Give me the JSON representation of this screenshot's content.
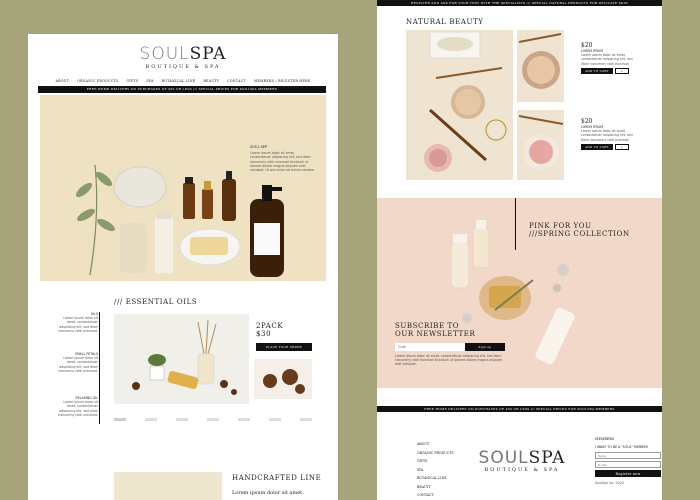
{
  "brand": {
    "name_a": "SOUL",
    "name_b": "SPA",
    "tagline": "BOUTIQUE & SPA"
  },
  "nav": {
    "items": [
      "ABOUT",
      "ORGANIC PRODUCTS",
      "GIFTS",
      "SPA",
      "BOTANICAL LINE",
      "BEAUTY",
      "CONTACT",
      "MEMBERS / REGISTER HERE"
    ]
  },
  "promo_banner": "FREE HOME DELIVERY ON PURCHASES OF $50 OR LESS /// SPECIAL PRICES FOR SOULSPA MEMBERS",
  "top_banner": "REGISTER AND ASK FOR YOUR TEST WITH THE SPECIALISTS /// SPECIAL NATURAL PRODUCTS FOR DELICATE SKIN",
  "hero": {
    "tag": "SOUL SPF",
    "text": "Lorem ipsum dolor sit amet, consectetuer adipiscing elit, sed diam nonummy nibh euismod tincidunt ut laoreet dolore magna aliquam erat volutpat. Ut wisi enim ad minim veniam."
  },
  "essential_oils": {
    "title": "/// ESSENTIAL OILS",
    "side_items": [
      {
        "label": "OILS",
        "text": "Lorem ipsum dolor sit amet, consectetuer adipiscing elit, sed diam nonummy nibh euismod."
      },
      {
        "label": "SMALL PETALS",
        "text": "Lorem ipsum dolor sit amet, consectetuer adipiscing elit, sed diam nonummy nibh euismod."
      },
      {
        "label": "RELAXING OIL",
        "text": "Lorem ipsum dolor sit amet, consectetuer adipiscing elit, sed diam nonummy nibh euismod."
      }
    ],
    "pack_title": "2PACK",
    "pack_price": "$30",
    "order_button": "PLACE YOUR ORDER"
  },
  "handcrafted": {
    "title": "HANDCRAFTED LINE",
    "text": "Lorem ipsum dolor sit amet,"
  },
  "natural_beauty": {
    "title": "NATURAL BEAUTY",
    "products": [
      {
        "price": "$20",
        "name": "LOREM IPSUM",
        "text": "Lorem ipsum dolor sit amet, consectetuer adipiscing elit, sed diam nonummy nibh euismod tincidunt ut laoreet dolore magna.",
        "cart": "ADD TO CART",
        "qty": "1"
      },
      {
        "price": "$20",
        "name": "LOREM IPSUM",
        "text": "Lorem ipsum dolor sit amet, consectetuer adipiscing elit, sed diam nonummy nibh euismod tincidunt ut laoreet dolore magna.",
        "cart": "ADD TO CART",
        "qty": "1"
      }
    ]
  },
  "spring": {
    "line1": "PINK FOR YOU",
    "line2": "///SPRING COLLECTION"
  },
  "newsletter": {
    "line1": "SUBSCRIBE TO",
    "line2": "OUR NEWSLETTER",
    "placeholder": "Email",
    "button": "Sign up",
    "text": "Lorem ipsum dolor sit amet, consectetuer adipiscing elit, sed diam nonummy nibh euismod tincidunt ut laoreet dolore magna aliquam erat volutpat."
  },
  "footer": {
    "links": [
      "ABOUT",
      "ORGANIC PRODUCTS",
      "GIFTS",
      "SPA",
      "BOTANICAL LINE",
      "BEAUTY",
      "CONTACT"
    ],
    "members_title": "MEMBERS",
    "members_sub": "I WANT TO BE A \"SOUL\" MEMBER",
    "name_placeholder": "Name",
    "email_placeholder": "E-mail",
    "register_button": "Register now",
    "small_text": "SoulSpa Inc. 2024"
  },
  "colors": {
    "background": "#a6a47a",
    "hero": "#efe2c3",
    "blush": "#f1d8c8",
    "black": "#111111"
  }
}
